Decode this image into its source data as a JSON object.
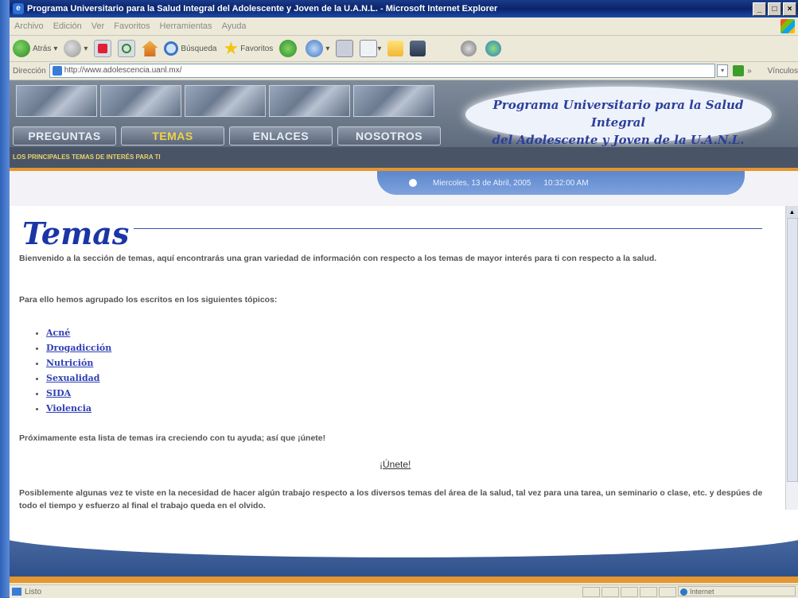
{
  "window": {
    "title": "Programa Universitario para la Salud Integral del Adolescente y Joven de la U.A.N.L. - Microsoft Internet Explorer",
    "controls": [
      "_",
      "□",
      "×"
    ]
  },
  "menu": [
    "Archivo",
    "Edición",
    "Ver",
    "Favoritos",
    "Herramientas",
    "Ayuda"
  ],
  "toolbar": {
    "back": "Atrás",
    "search": "Búsqueda",
    "favorites": "Favoritos"
  },
  "address": {
    "label": "Dirección",
    "url": "http://www.adolescencia.uanl.mx/",
    "links": "Vínculos"
  },
  "site": {
    "logo_line1": "Programa Universitario para la Salud Integral",
    "logo_line2": "del Adolescente y Joven de la U.A.N.L.",
    "nav": [
      "PREGUNTAS",
      "TEMAS",
      "ENLACES",
      "NOSOTROS"
    ],
    "subtitle": "LOS PRINCIPALES TEMAS DE INTERÉS PARA TI",
    "date": "Miercoles, 13 de Abril, 2005",
    "time": "10:32:00 AM"
  },
  "page": {
    "heading": "Temas",
    "intro": "Bienvenido a la sección de temas, aquí encontrarás una gran variedad de información con respecto a los temas de mayor interés para ti con respecto a la salud.",
    "grouped": "Para ello hemos agrupado los escritos en los siguientes tópicos:",
    "topics": [
      "Acné",
      "Drogadicción",
      "Nutrición",
      "Sexualidad",
      "SIDA",
      "Violencia"
    ],
    "growing": "Próximamente esta lista de temas ira creciendo con tu ayuda; así que ¡únete!",
    "join": "¡Únete!",
    "bottom": "Posiblemente algunas vez te viste en la necesidad de hacer algún trabajo respecto a los diversos temas del área de la salud, tal vez para una tarea, un seminario o clase, etc. y despúes de todo el tiempo y esfuerzo al final el trabajo queda en el olvido."
  },
  "status": {
    "text": "Listo",
    "zone": "Internet"
  },
  "colors": {
    "accent": "#1a35a5",
    "nav_active": "#f0d24a",
    "orange": "#e5962f"
  }
}
